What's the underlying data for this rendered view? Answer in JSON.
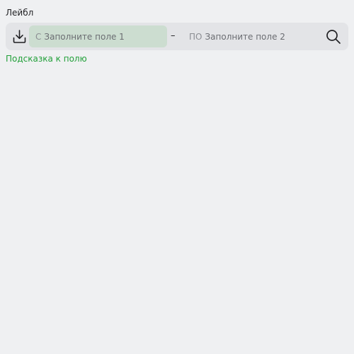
{
  "field": {
    "label": "Лейбл",
    "download_icon": "download-icon",
    "from": {
      "prefix": "С",
      "placeholder": "Заполните поле 1"
    },
    "separator": "–",
    "to": {
      "prefix": "ПО",
      "placeholder": "Заполните поле 2"
    },
    "search_icon": "search-icon",
    "hint": "Подсказка к полю"
  },
  "colors": {
    "background": "#eff0f2",
    "field_background": "#e3e4e7",
    "active_input": "#ccddd0",
    "hint": "#22a03a"
  }
}
